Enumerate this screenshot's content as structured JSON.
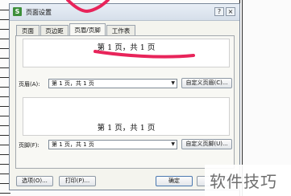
{
  "window": {
    "title": "页面设置",
    "icon_letter": "S",
    "help_glyph": "?",
    "close_glyph": "×"
  },
  "tabs": [
    {
      "label": "页面",
      "active": false
    },
    {
      "label": "页边距",
      "active": false
    },
    {
      "label": "页眉/页脚",
      "active": true
    },
    {
      "label": "工作表",
      "active": false
    }
  ],
  "header": {
    "preview_text": "第 1 页，共 1 页",
    "label": "页眉(A):",
    "selected_value": "第 1 页，共 1 页",
    "custom_button": "自定义页眉(C)..."
  },
  "footer": {
    "preview_text": "第 1 页，共 1 页",
    "label": "页脚(F):",
    "selected_value": "第 1 页，共 1 页",
    "custom_button": "自定义页脚(U)..."
  },
  "buttons": {
    "options": "选项(O)...",
    "print": "打印(P)...",
    "ok": "确定",
    "cancel": ""
  },
  "watermark": {
    "text": "软件技巧"
  },
  "annotation_color": "#e8245a"
}
